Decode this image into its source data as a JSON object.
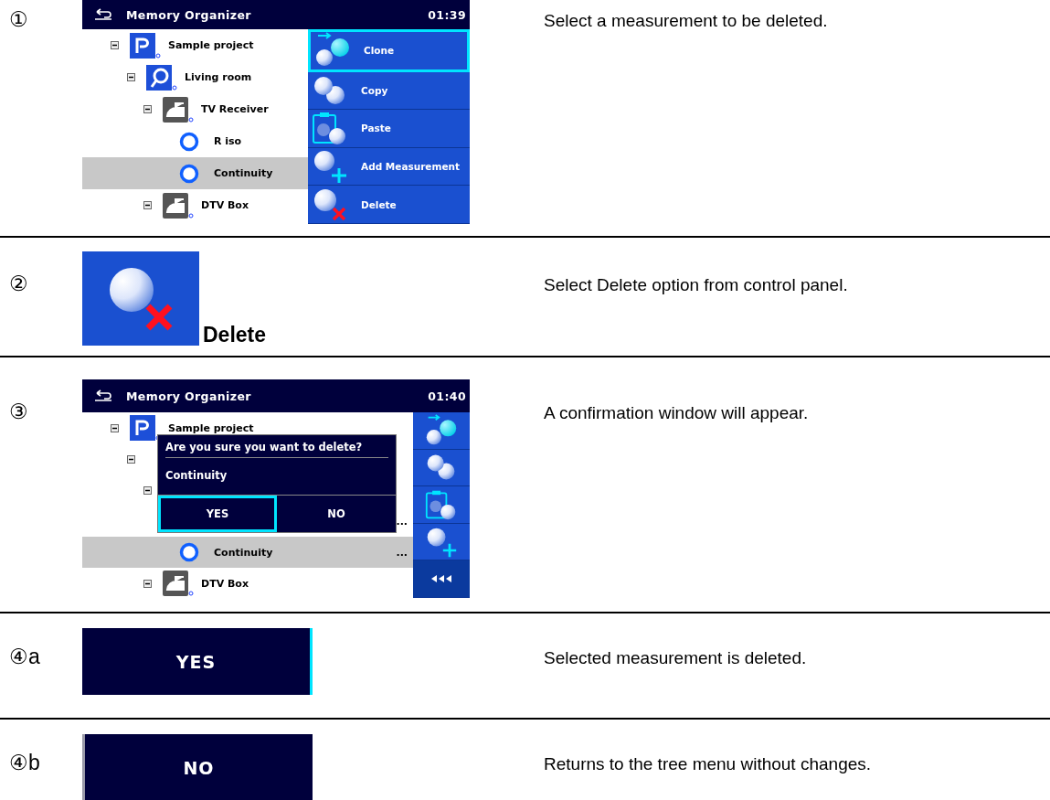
{
  "steps": [
    {
      "marker": "①",
      "kind": "menu_screen",
      "screen": {
        "title": "Memory Organizer",
        "time": "01:39",
        "tree": [
          {
            "label": "Sample project",
            "kind": "project",
            "expanded": true,
            "selected": false,
            "children": [
              {
                "label": "Living room",
                "kind": "location",
                "expanded": true,
                "selected": false,
                "children": [
                  {
                    "label": "TV Receiver",
                    "kind": "device",
                    "expanded": true,
                    "selected": false,
                    "children": [
                      {
                        "label": "R iso",
                        "kind": "measurement",
                        "selected": false
                      },
                      {
                        "label": "Continuity",
                        "kind": "measurement",
                        "selected": true
                      }
                    ]
                  },
                  {
                    "label": "DTV Box",
                    "kind": "device",
                    "expanded": true,
                    "selected": false
                  }
                ]
              }
            ]
          }
        ],
        "menu": [
          {
            "label": "Clone",
            "kind": "clone",
            "selected": true
          },
          {
            "label": "Copy",
            "kind": "copy",
            "selected": false
          },
          {
            "label": "Paste",
            "kind": "paste",
            "selected": false
          },
          {
            "label": "Add Measurement",
            "kind": "add",
            "selected": false
          },
          {
            "label": "Delete",
            "kind": "delete",
            "selected": false
          }
        ]
      },
      "description": "Select a measurement to be deleted."
    },
    {
      "marker": "②",
      "kind": "icon_button",
      "button": {
        "label": "Delete",
        "kind": "delete"
      },
      "description": "Select Delete option from control panel."
    },
    {
      "marker": "③",
      "kind": "dialog_screen",
      "screen": {
        "title": "Memory Organizer",
        "time": "01:40",
        "tree": [
          {
            "label": "Sample project",
            "kind": "project",
            "expanded": true,
            "selected": false,
            "children": [
              {
                "expanded": true,
                "selected": false,
                "children": [
                  {
                    "expanded": true,
                    "selected": false,
                    "children": [
                      {
                        "more": "...",
                        "selected": false
                      },
                      {
                        "label": "Continuity",
                        "kind": "measurement",
                        "more": "...",
                        "selected": true
                      }
                    ]
                  },
                  {
                    "label": "DTV Box",
                    "kind": "device",
                    "expanded": true,
                    "selected": false
                  }
                ]
              }
            ]
          }
        ],
        "side_buttons": [
          {
            "kind": "clone"
          },
          {
            "kind": "copy"
          },
          {
            "kind": "paste"
          },
          {
            "kind": "add"
          },
          {
            "kind": "back"
          }
        ],
        "dialog": {
          "question": "Are you sure you want to delete?",
          "item": "Continuity",
          "buttons": [
            {
              "label": "YES",
              "selected": true
            },
            {
              "label": "NO",
              "selected": false
            }
          ]
        }
      },
      "description": "A confirmation window will appear."
    },
    {
      "marker": "④",
      "suffix": "a",
      "kind": "plain_button",
      "button": {
        "label": "YES",
        "kind": "right"
      },
      "description": "Selected measurement is deleted."
    },
    {
      "marker": "④",
      "suffix": "b",
      "kind": "plain_button",
      "button": {
        "label": "NO",
        "kind": "left"
      },
      "description": "Returns to the tree menu without changes."
    }
  ]
}
